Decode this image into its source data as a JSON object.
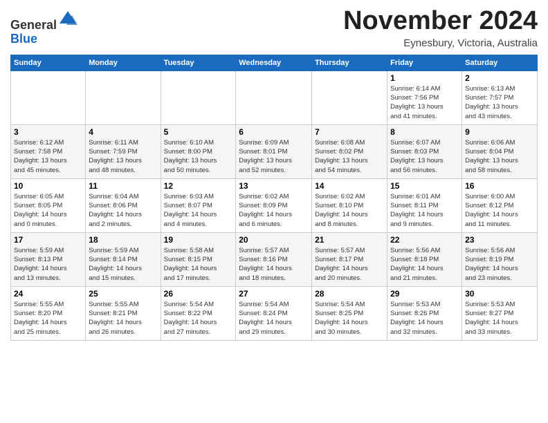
{
  "header": {
    "logo": {
      "line1": "General",
      "line2": "Blue"
    },
    "title": "November 2024",
    "subtitle": "Eynesbury, Victoria, Australia"
  },
  "days_of_week": [
    "Sunday",
    "Monday",
    "Tuesday",
    "Wednesday",
    "Thursday",
    "Friday",
    "Saturday"
  ],
  "weeks": [
    [
      {
        "day": "",
        "detail": ""
      },
      {
        "day": "",
        "detail": ""
      },
      {
        "day": "",
        "detail": ""
      },
      {
        "day": "",
        "detail": ""
      },
      {
        "day": "",
        "detail": ""
      },
      {
        "day": "1",
        "detail": "Sunrise: 6:14 AM\nSunset: 7:56 PM\nDaylight: 13 hours\nand 41 minutes."
      },
      {
        "day": "2",
        "detail": "Sunrise: 6:13 AM\nSunset: 7:57 PM\nDaylight: 13 hours\nand 43 minutes."
      }
    ],
    [
      {
        "day": "3",
        "detail": "Sunrise: 6:12 AM\nSunset: 7:58 PM\nDaylight: 13 hours\nand 45 minutes."
      },
      {
        "day": "4",
        "detail": "Sunrise: 6:11 AM\nSunset: 7:59 PM\nDaylight: 13 hours\nand 48 minutes."
      },
      {
        "day": "5",
        "detail": "Sunrise: 6:10 AM\nSunset: 8:00 PM\nDaylight: 13 hours\nand 50 minutes."
      },
      {
        "day": "6",
        "detail": "Sunrise: 6:09 AM\nSunset: 8:01 PM\nDaylight: 13 hours\nand 52 minutes."
      },
      {
        "day": "7",
        "detail": "Sunrise: 6:08 AM\nSunset: 8:02 PM\nDaylight: 13 hours\nand 54 minutes."
      },
      {
        "day": "8",
        "detail": "Sunrise: 6:07 AM\nSunset: 8:03 PM\nDaylight: 13 hours\nand 56 minutes."
      },
      {
        "day": "9",
        "detail": "Sunrise: 6:06 AM\nSunset: 8:04 PM\nDaylight: 13 hours\nand 58 minutes."
      }
    ],
    [
      {
        "day": "10",
        "detail": "Sunrise: 6:05 AM\nSunset: 8:05 PM\nDaylight: 14 hours\nand 0 minutes."
      },
      {
        "day": "11",
        "detail": "Sunrise: 6:04 AM\nSunset: 8:06 PM\nDaylight: 14 hours\nand 2 minutes."
      },
      {
        "day": "12",
        "detail": "Sunrise: 6:03 AM\nSunset: 8:07 PM\nDaylight: 14 hours\nand 4 minutes."
      },
      {
        "day": "13",
        "detail": "Sunrise: 6:02 AM\nSunset: 8:09 PM\nDaylight: 14 hours\nand 6 minutes."
      },
      {
        "day": "14",
        "detail": "Sunrise: 6:02 AM\nSunset: 8:10 PM\nDaylight: 14 hours\nand 8 minutes."
      },
      {
        "day": "15",
        "detail": "Sunrise: 6:01 AM\nSunset: 8:11 PM\nDaylight: 14 hours\nand 9 minutes."
      },
      {
        "day": "16",
        "detail": "Sunrise: 6:00 AM\nSunset: 8:12 PM\nDaylight: 14 hours\nand 11 minutes."
      }
    ],
    [
      {
        "day": "17",
        "detail": "Sunrise: 5:59 AM\nSunset: 8:13 PM\nDaylight: 14 hours\nand 13 minutes."
      },
      {
        "day": "18",
        "detail": "Sunrise: 5:59 AM\nSunset: 8:14 PM\nDaylight: 14 hours\nand 15 minutes."
      },
      {
        "day": "19",
        "detail": "Sunrise: 5:58 AM\nSunset: 8:15 PM\nDaylight: 14 hours\nand 17 minutes."
      },
      {
        "day": "20",
        "detail": "Sunrise: 5:57 AM\nSunset: 8:16 PM\nDaylight: 14 hours\nand 18 minutes."
      },
      {
        "day": "21",
        "detail": "Sunrise: 5:57 AM\nSunset: 8:17 PM\nDaylight: 14 hours\nand 20 minutes."
      },
      {
        "day": "22",
        "detail": "Sunrise: 5:56 AM\nSunset: 8:18 PM\nDaylight: 14 hours\nand 21 minutes."
      },
      {
        "day": "23",
        "detail": "Sunrise: 5:56 AM\nSunset: 8:19 PM\nDaylight: 14 hours\nand 23 minutes."
      }
    ],
    [
      {
        "day": "24",
        "detail": "Sunrise: 5:55 AM\nSunset: 8:20 PM\nDaylight: 14 hours\nand 25 minutes."
      },
      {
        "day": "25",
        "detail": "Sunrise: 5:55 AM\nSunset: 8:21 PM\nDaylight: 14 hours\nand 26 minutes."
      },
      {
        "day": "26",
        "detail": "Sunrise: 5:54 AM\nSunset: 8:22 PM\nDaylight: 14 hours\nand 27 minutes."
      },
      {
        "day": "27",
        "detail": "Sunrise: 5:54 AM\nSunset: 8:24 PM\nDaylight: 14 hours\nand 29 minutes."
      },
      {
        "day": "28",
        "detail": "Sunrise: 5:54 AM\nSunset: 8:25 PM\nDaylight: 14 hours\nand 30 minutes."
      },
      {
        "day": "29",
        "detail": "Sunrise: 5:53 AM\nSunset: 8:26 PM\nDaylight: 14 hours\nand 32 minutes."
      },
      {
        "day": "30",
        "detail": "Sunrise: 5:53 AM\nSunset: 8:27 PM\nDaylight: 14 hours\nand 33 minutes."
      }
    ]
  ]
}
